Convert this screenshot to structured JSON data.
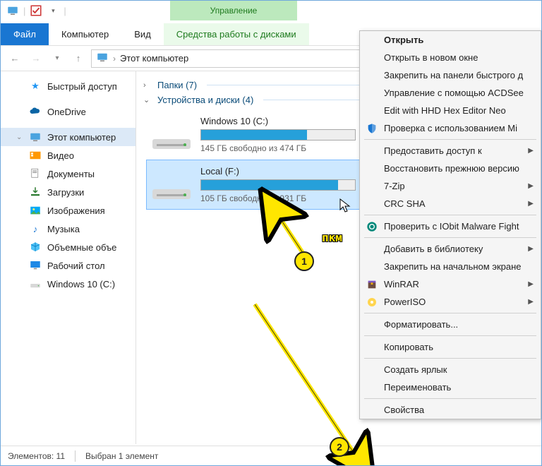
{
  "window": {
    "title": "Этот компьютер",
    "management_label": "Управление"
  },
  "ribbon": {
    "file": "Файл",
    "computer": "Компьютер",
    "view": "Вид",
    "disk_tools": "Средства работы с дисками"
  },
  "address": {
    "segment": "Этот компьютер"
  },
  "sidebar": {
    "quick_access": "Быстрый доступ",
    "onedrive": "OneDrive",
    "this_pc": "Этот компьютер",
    "video": "Видео",
    "documents": "Документы",
    "downloads": "Загрузки",
    "pictures": "Изображения",
    "music": "Музыка",
    "objects_3d": "Объемные объе",
    "desktop": "Рабочий стол",
    "drive_c": "Windows 10 (C:)"
  },
  "main": {
    "group_folders": "Папки (7)",
    "group_drives": "Устройства и диски (4)",
    "drives": [
      {
        "name": "Windows 10 (C:)",
        "free_text": "145 ГБ свободно из 474 ГБ",
        "fill_pct": 69
      },
      {
        "name": "Local (F:)",
        "free_text": "105 ГБ свободно из 931 ГБ",
        "fill_pct": 89
      }
    ]
  },
  "status": {
    "count": "Элементов: 11",
    "selection": "Выбран 1 элемент"
  },
  "context_menu": {
    "open": "Открыть",
    "open_new": "Открыть в новом окне",
    "pin_quick": "Закрепить на панели быстрого д",
    "acdsee": "Управление с помощью ACDSee",
    "hexedit": "Edit with HHD Hex Editor Neo",
    "defender": "Проверка с использованием Mi",
    "give_access": "Предоставить доступ к",
    "restore_prev": "Восстановить прежнюю версию",
    "sevenzip": "7-Zip",
    "crc": "CRC SHA",
    "iobit": "Проверить с IObit Malware Fight",
    "add_lib": "Добавить в библиотеку",
    "pin_start": "Закрепить на начальном экране",
    "winrar": "WinRAR",
    "poweriso": "PowerISO",
    "format": "Форматировать...",
    "copy": "Копировать",
    "shortcut": "Создать ярлык",
    "rename": "Переименовать",
    "properties": "Свойства"
  },
  "annotation": {
    "badge1": "1",
    "badge2": "2",
    "rmb": "пкм"
  }
}
